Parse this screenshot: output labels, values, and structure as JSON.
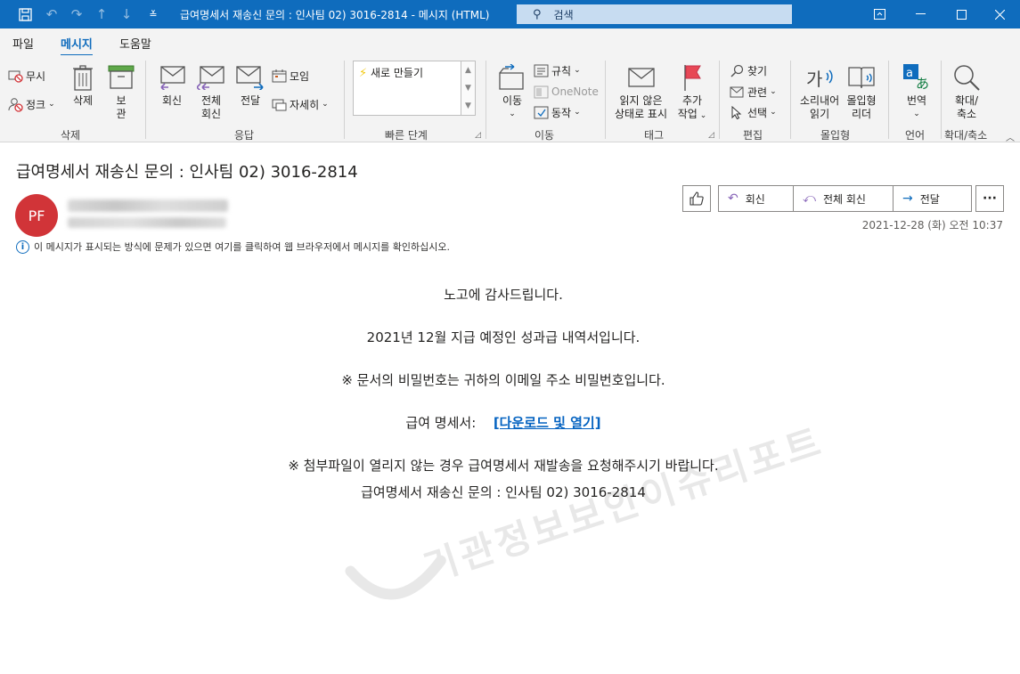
{
  "window": {
    "title": "급여명세서 재송신 문의 : 인사팀 02) 3016-2814  -  메시지 (HTML)",
    "search_placeholder": "검색"
  },
  "tabs": [
    "파일",
    "메시지",
    "도움말"
  ],
  "ribbon": {
    "delete_group": {
      "label": "삭제",
      "ignore": "무시",
      "junk": "정크",
      "delete": "삭제",
      "archive_1": "보",
      "archive_2": "관"
    },
    "respond_group": {
      "label": "응답",
      "reply": "회신",
      "reply_all_1": "전체",
      "reply_all_2": "회신",
      "forward": "전달",
      "meeting": "모임",
      "more": "자세히"
    },
    "quick_steps": {
      "label": "빠른 단계",
      "new": "새로 만들기"
    },
    "move_group": {
      "label": "이동",
      "move": "이동",
      "rules": "규칙",
      "onenote": "OneNote",
      "actions": "동작"
    },
    "tags_group": {
      "label": "태그",
      "unread_1": "읽지 않은",
      "unread_2": "상태로 표시",
      "followup_1": "추가",
      "followup_2": "작업"
    },
    "editing_group": {
      "label": "편집",
      "find": "찾기",
      "related": "관련",
      "select": "선택"
    },
    "immersive_group": {
      "label": "몰입형",
      "read_aloud_1": "소리내어",
      "read_aloud_2": "읽기",
      "reader_1": "몰입형",
      "reader_2": "리더"
    },
    "language_group": {
      "label": "언어",
      "translate": "번역"
    },
    "zoom_group": {
      "label": "확대/축소",
      "zoom_1": "확대/",
      "zoom_2": "축소"
    }
  },
  "message": {
    "subject": "급여명세서 재송신 문의 : 인사팀 02) 3016-2814",
    "sender_initials": "PF",
    "actions": {
      "reply": "회신",
      "reply_all": "전체 회신",
      "forward": "전달"
    },
    "date": "2021-12-28 (화) 오전 10:37",
    "info_text": "이 메시지가 표시되는 방식에 문제가 있으면 여기를 클릭하여 웹 브라우저에서 메시지를 확인하십시오.",
    "body": {
      "line1": "노고에 감사드립니다.",
      "line2": "2021년 12월 지급 예정인 성과급 내역서입니다.",
      "line3": "※ 문서의 비밀번호는 귀하의 이메일 주소 비밀번호입니다.",
      "line4_label": "급여 명세서:",
      "line4_link": "[다운로드 및 열기]",
      "line5": "※ 첨부파일이 열리지 않는 경우 급여명세서 재발송을 요청해주시기 바랍니다.",
      "line6": "급여명세서 재송신 문의 : 인사팀 02) 3016-2814"
    }
  },
  "watermark": "기관정보보안이슈리포트",
  "colors": {
    "accent": "#0f6cbd",
    "avatar": "#d13438",
    "link": "#0563c1",
    "flag": "#e74856"
  }
}
